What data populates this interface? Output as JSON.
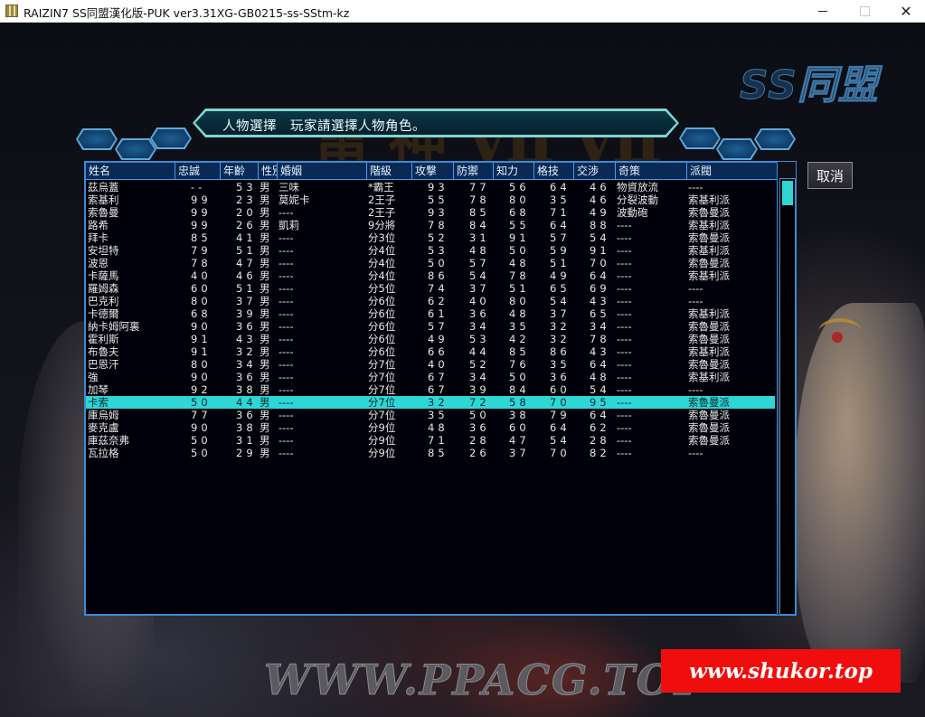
{
  "window": {
    "title": "RAIZIN7 SS同盟漢化版-PUK  ver3.31XG-GB0215-ss-SStm-kz",
    "minimize_icon": "minimize-icon",
    "maximize_icon": "maximize-icon",
    "close_glyph": "✕"
  },
  "background": {
    "logo": "SS同盟",
    "watermark_back": "WWW.PPACG.TOP",
    "watermark_red": "www.shukor.top"
  },
  "header": {
    "title": "人物選擇　玩家請選擇人物角色。"
  },
  "buttons": {
    "cancel": "取消"
  },
  "table": {
    "columns": [
      "姓名",
      "忠誠",
      "年齡",
      "性別",
      "婚姻",
      "階級",
      "攻撃",
      "防禦",
      "知力",
      "格技",
      "交渉",
      "奇策",
      "派閥"
    ],
    "selected_index": 17,
    "rows": [
      [
        "茲烏蓋",
        "--",
        "53",
        "男",
        "三味",
        "*霸王",
        "93",
        "77",
        "56",
        "64",
        "46",
        "物資放流",
        "----"
      ],
      [
        "索基利",
        "99",
        "23",
        "男",
        "莫妮卡",
        "2王子",
        "55",
        "78",
        "80",
        "35",
        "46",
        "分裂波動",
        "索基利派"
      ],
      [
        "索魯曼",
        "99",
        "20",
        "男",
        "----",
        "2王子",
        "93",
        "85",
        "68",
        "71",
        "49",
        "波動砲",
        "索魯曼派"
      ],
      [
        "路希",
        "99",
        "26",
        "男",
        "凱莉",
        "9分將",
        "78",
        "84",
        "55",
        "64",
        "88",
        "----",
        "索基利派"
      ],
      [
        "拜卡",
        "85",
        "41",
        "男",
        "----",
        "分3位",
        "52",
        "31",
        "91",
        "57",
        "54",
        "----",
        "索魯曼派"
      ],
      [
        "安坦特",
        "79",
        "51",
        "男",
        "----",
        "分4位",
        "53",
        "48",
        "50",
        "59",
        "91",
        "----",
        "索基利派"
      ],
      [
        "波恩",
        "78",
        "47",
        "男",
        "----",
        "分4位",
        "50",
        "57",
        "48",
        "51",
        "70",
        "----",
        "索魯曼派"
      ],
      [
        "卡薩馬",
        "40",
        "46",
        "男",
        "----",
        "分4位",
        "86",
        "54",
        "78",
        "49",
        "64",
        "----",
        "索基利派"
      ],
      [
        "羅姆森",
        "60",
        "51",
        "男",
        "----",
        "分5位",
        "74",
        "37",
        "51",
        "65",
        "69",
        "----",
        "----"
      ],
      [
        "巴克利",
        "80",
        "37",
        "男",
        "----",
        "分6位",
        "62",
        "40",
        "80",
        "54",
        "43",
        "----",
        "----"
      ],
      [
        "卡德爾",
        "68",
        "39",
        "男",
        "----",
        "分6位",
        "61",
        "36",
        "48",
        "37",
        "65",
        "----",
        "索基利派"
      ],
      [
        "納卡姆阿裏",
        "90",
        "36",
        "男",
        "----",
        "分6位",
        "57",
        "34",
        "35",
        "32",
        "34",
        "----",
        "索魯曼派"
      ],
      [
        "霍利斯",
        "91",
        "43",
        "男",
        "----",
        "分6位",
        "49",
        "53",
        "42",
        "32",
        "78",
        "----",
        "索魯曼派"
      ],
      [
        "布魯夫",
        "91",
        "32",
        "男",
        "----",
        "分6位",
        "66",
        "44",
        "85",
        "86",
        "43",
        "----",
        "索基利派"
      ],
      [
        "巴恩汗",
        "80",
        "34",
        "男",
        "----",
        "分7位",
        "40",
        "52",
        "76",
        "35",
        "64",
        "----",
        "索魯曼派"
      ],
      [
        "強",
        "90",
        "36",
        "男",
        "----",
        "分7位",
        "67",
        "34",
        "50",
        "36",
        "48",
        "----",
        "索基利派"
      ],
      [
        "加琴",
        "92",
        "38",
        "男",
        "----",
        "分7位",
        "67",
        "39",
        "84",
        "60",
        "54",
        "----",
        "----"
      ],
      [
        "卡索",
        "50",
        "44",
        "男",
        "----",
        "分7位",
        "32",
        "72",
        "58",
        "70",
        "95",
        "----",
        "索魯曼派"
      ],
      [
        "庫烏姆",
        "77",
        "36",
        "男",
        "----",
        "分7位",
        "35",
        "50",
        "38",
        "79",
        "64",
        "----",
        "索魯曼派"
      ],
      [
        "麥克盧",
        "90",
        "38",
        "男",
        "----",
        "分9位",
        "48",
        "36",
        "60",
        "64",
        "62",
        "----",
        "索魯曼派"
      ],
      [
        "庫茲奈弗",
        "50",
        "31",
        "男",
        "----",
        "分9位",
        "71",
        "28",
        "47",
        "54",
        "28",
        "----",
        "索魯曼派"
      ],
      [
        "瓦拉格",
        "50",
        "29",
        "男",
        "----",
        "分9位",
        "85",
        "26",
        "37",
        "70",
        "82",
        "----",
        "----"
      ]
    ]
  },
  "colors": {
    "selection": "#2fd6d6",
    "header_bg": "#0a2a55",
    "border": "#3a8cd6"
  }
}
